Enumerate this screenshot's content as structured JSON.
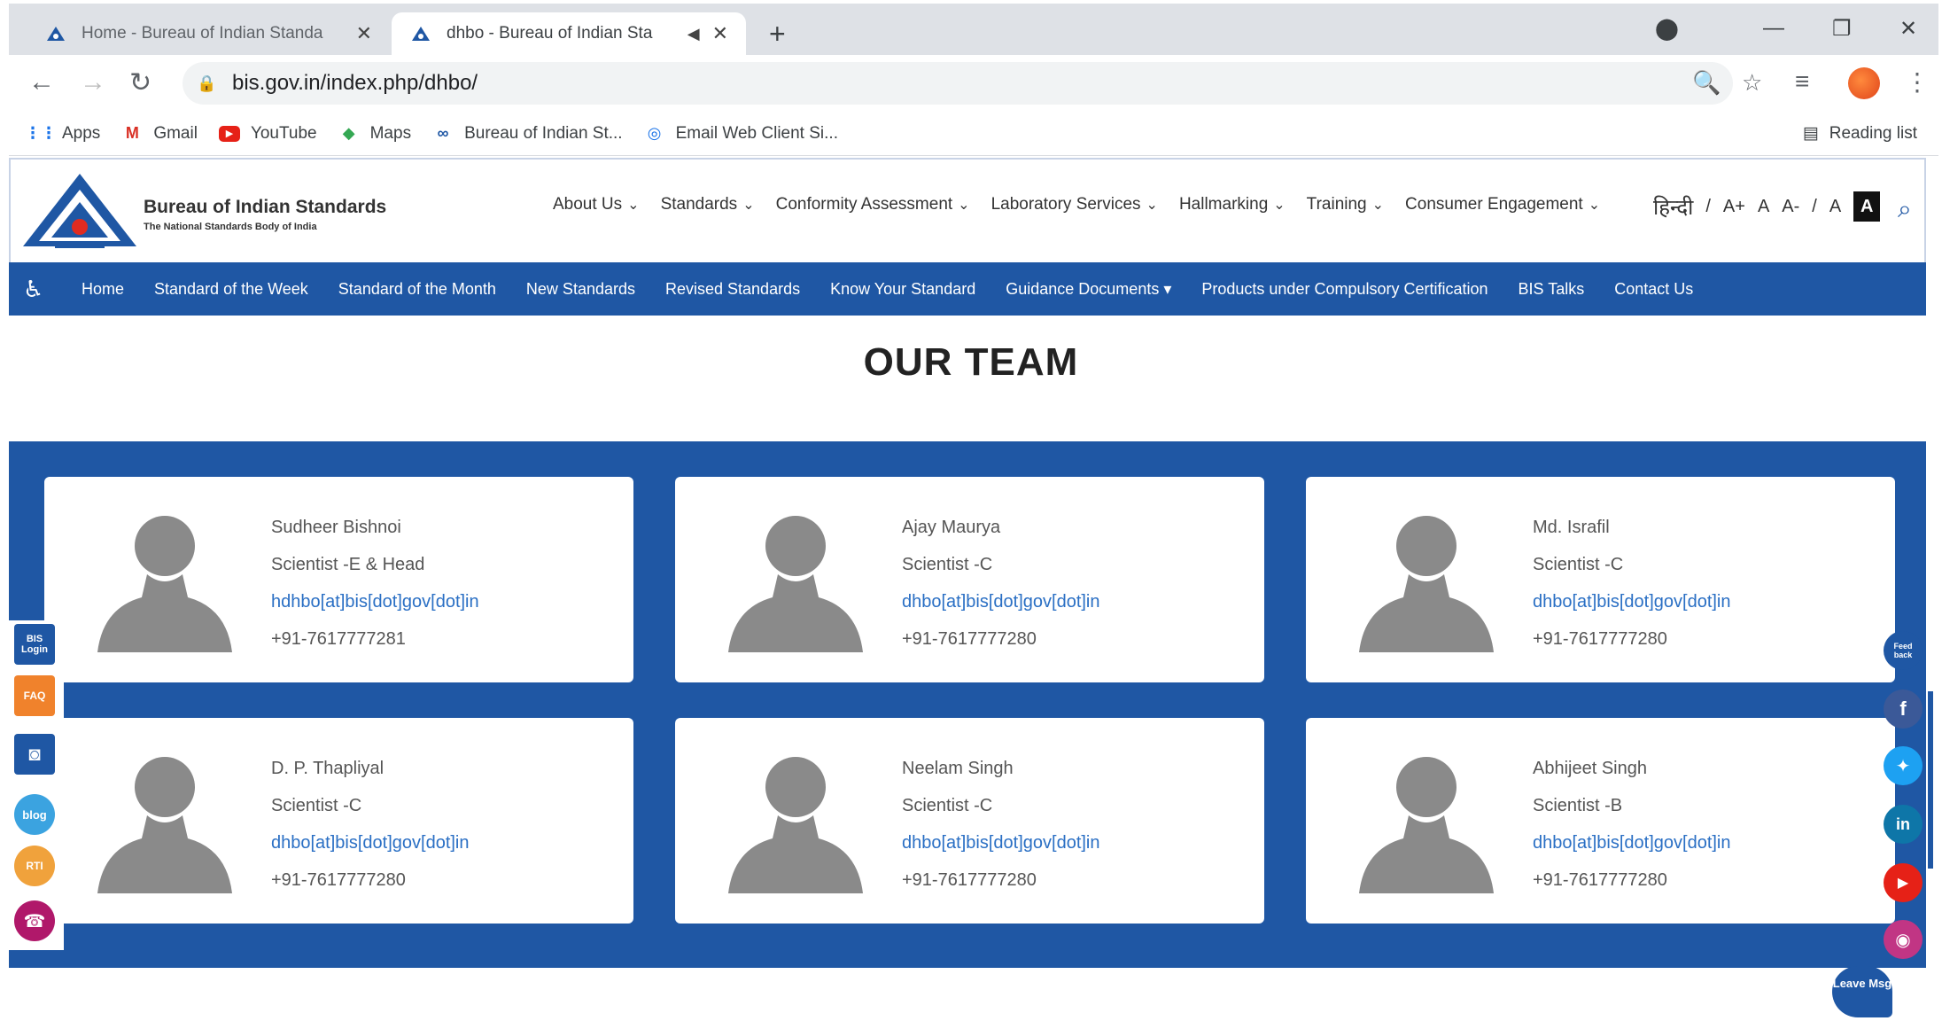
{
  "browser": {
    "tabs": [
      {
        "title": "Home - Bureau of Indian Standa",
        "active": false
      },
      {
        "title": "dhbo - Bureau of Indian Sta",
        "active": true
      }
    ],
    "address": "bis.gov.in/index.php/dhbo/",
    "bookmarks": [
      "Apps",
      "Gmail",
      "YouTube",
      "Maps",
      "Bureau of Indian St...",
      "Email Web Client Si..."
    ],
    "reading_list": "Reading list"
  },
  "site": {
    "brand_title": "Bureau of Indian Standards",
    "brand_subtitle": "The National Standards Body of India",
    "main_nav": [
      "About Us",
      "Standards",
      "Conformity Assessment",
      "Laboratory Services",
      "Hallmarking",
      "Training",
      "Consumer Engagement"
    ],
    "font_tools": {
      "hindi": "हिन्दी",
      "sep": "/",
      "a_plus": "A+",
      "a": "A",
      "a_minus": "A-",
      "a_normal": "A",
      "contrast": "A"
    },
    "sub_nav": [
      "Home",
      "Standard of the Week",
      "Standard of the Month",
      "New Standards",
      "Revised Standards",
      "Know Your Standard",
      "Guidance Documents ▾",
      "Products under Compulsory Certification",
      "BIS Talks",
      "Contact Us"
    ]
  },
  "team": {
    "title": "OUR TEAM",
    "members": [
      {
        "name": "Sudheer Bishnoi",
        "role": "Scientist -E & Head",
        "email": "hdhbo[at]bis[dot]gov[dot]in",
        "phone": "+91-7617777281"
      },
      {
        "name": "Ajay Maurya",
        "role": "Scientist -C",
        "email": "dhbo[at]bis[dot]gov[dot]in",
        "phone": "+91-7617777280"
      },
      {
        "name": "Md. Israfil",
        "role": "Scientist -C",
        "email": "dhbo[at]bis[dot]gov[dot]in",
        "phone": "+91-7617777280"
      },
      {
        "name": "D. P. Thapliyal",
        "role": "Scientist -C",
        "email": "dhbo[at]bis[dot]gov[dot]in",
        "phone": "+91-7617777280"
      },
      {
        "name": "Neelam Singh",
        "role": "Scientist -C",
        "email": "dhbo[at]bis[dot]gov[dot]in",
        "phone": "+91-7617777280"
      },
      {
        "name": "Abhijeet Singh",
        "role": "Scientist -B",
        "email": "dhbo[at]bis[dot]gov[dot]in",
        "phone": "+91-7617777280"
      }
    ]
  },
  "left_tools": {
    "login": "BIS Login",
    "faq": "FAQ",
    "camera": "",
    "blog": "blog",
    "rti": "RTI",
    "help": ""
  },
  "social": {
    "feedback": "Feed back",
    "leave_msg": "Leave Msg"
  },
  "colors": {
    "primary": "#1f57a4",
    "faq": "#f0822c",
    "facebook": "#3b5998",
    "twitter": "#1da1f2",
    "linkedin": "#0e76a8",
    "youtube": "#e62117",
    "instagram": "#c13584"
  }
}
